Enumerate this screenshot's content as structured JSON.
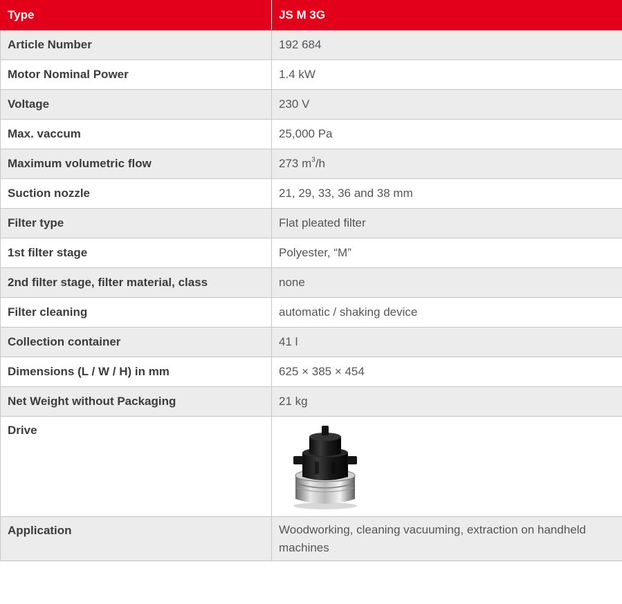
{
  "header": {
    "col1": "Type",
    "col2": "JS M 3G"
  },
  "rows": [
    {
      "label": "Article Number",
      "value": "192 684"
    },
    {
      "label": "Motor Nominal Power",
      "value": "1.4 kW"
    },
    {
      "label": "Voltage",
      "value": "230 V"
    },
    {
      "label": "Max. vaccum",
      "value": "25,000 Pa"
    },
    {
      "label": "Maximum volumetric flow",
      "value_main": "273 m",
      "value_sup": "3",
      "value_tail": "/h"
    },
    {
      "label": "Suction nozzle",
      "value": "21, 29, 33, 36 and 38 mm"
    },
    {
      "label": "Filter type",
      "value": "Flat pleated filter"
    },
    {
      "label": "1st filter stage",
      "value": "Polyester, “M”"
    },
    {
      "label": "2nd filter stage, filter material, class",
      "value": "none"
    },
    {
      "label": "Filter cleaning",
      "value": "automatic / shaking device"
    },
    {
      "label": "Collection container",
      "value": "41 l"
    },
    {
      "label": "Dimensions (L / W / H) in mm",
      "value": "625 × 385 × 454"
    },
    {
      "label": "Net Weight without Packaging",
      "value": "21 kg"
    },
    {
      "label": "Drive",
      "image": "vacuum-motor-image"
    },
    {
      "label": "Application",
      "value": "Woodworking, cleaning vacuuming, extraction on handheld machines"
    }
  ],
  "colors": {
    "header_bg": "#e2001a",
    "header_text": "#ffffff",
    "stripe": "#ececec",
    "border": "#c6c6c6"
  }
}
